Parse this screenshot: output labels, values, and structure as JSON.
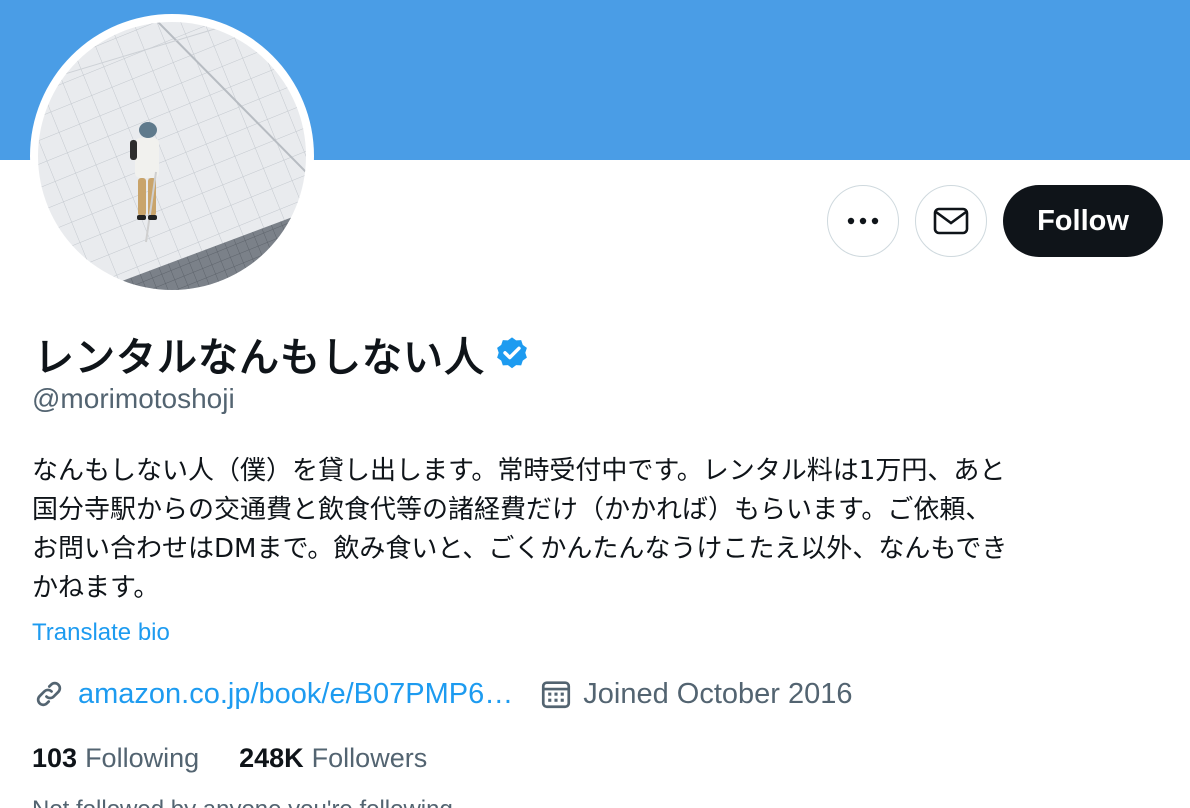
{
  "profile": {
    "display_name": "レンタルなんもしない人",
    "handle": "@morimotoshoji",
    "bio": "なんもしない人（僕）を貸し出します。常時受付中です。レンタル料は1万円、あと\n国分寺駅からの交通費と飲食代等の諸経費だけ（かかれば）もらいます。ご依頼、\nお問い合わせはDMまで。飲み食いと、ごくかんたんなうけこたえ以外、なんもでき\nかねます。",
    "translate_label": "Translate bio",
    "url": "amazon.co.jp/book/e/B07PMP6…",
    "joined": "Joined October 2016",
    "following_count": "103",
    "following_label": "Following",
    "followers_count": "248K",
    "followers_label": "Followers",
    "followed_by": "Not followed by anyone you're following"
  },
  "actions": {
    "follow_label": "Follow"
  },
  "icons": {
    "more": "more-icon",
    "message": "envelope-icon",
    "verified": "verified-badge-icon",
    "link": "link-icon",
    "calendar": "calendar-icon"
  },
  "colors": {
    "banner": "#4a9de6",
    "accent": "#1d9bf0",
    "text_primary": "#0f1419",
    "text_secondary": "#536471",
    "button_dark": "#0f1419"
  }
}
